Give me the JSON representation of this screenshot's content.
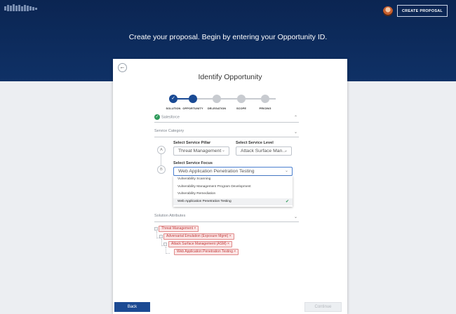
{
  "header": {
    "create_button": "CREATE PROPOSAL",
    "title": "Create your proposal. Begin by entering your Opportunity ID."
  },
  "card": {
    "title": "Identify Opportunity",
    "back_icon": "arrow-left-icon"
  },
  "stepper": {
    "steps": [
      {
        "label": "SOLUTION",
        "state": "done"
      },
      {
        "label": "OPPORTUNITY",
        "state": "active"
      },
      {
        "label": "DELEGATION",
        "state": "pending"
      },
      {
        "label": "SCOPE",
        "state": "pending"
      },
      {
        "label": "PRICING",
        "state": "pending"
      }
    ]
  },
  "salesforce": {
    "label": "Salesforce"
  },
  "service_category": {
    "label": "Service Category",
    "pillar_label": "Select Service Pillar",
    "pillar_value": "Threat Management",
    "level_label": "Select Service Level",
    "level_value": "Attack Surface Man...",
    "focus_label": "Select Service Focus",
    "focus_value": "Web Application Penetration Testing",
    "marker_a": "A",
    "marker_b": "B",
    "options": [
      "Vulnerability Scanning",
      "Vulnerability Management Program Development",
      "Vulnerability Remediation",
      "Web Application Penetration Testing"
    ],
    "selected_option": "Web Application Penetration Testing"
  },
  "solution_attributes": {
    "label": "Solution Attributes",
    "tags": [
      "Threat Management ×",
      "Adversarial Emulation (Exposure Mgmt) ×",
      "Attack Surface Management (ASM) ×",
      "Web Application Penetration Testing ×"
    ]
  },
  "footer": {
    "back": "Back",
    "continue": "Continue"
  },
  "colors": {
    "hero": "#0d2c5e",
    "primary": "#1c4a93",
    "tag_border": "#e08a8a",
    "tag_text": "#c23a3a",
    "success": "#2e9a5a"
  }
}
